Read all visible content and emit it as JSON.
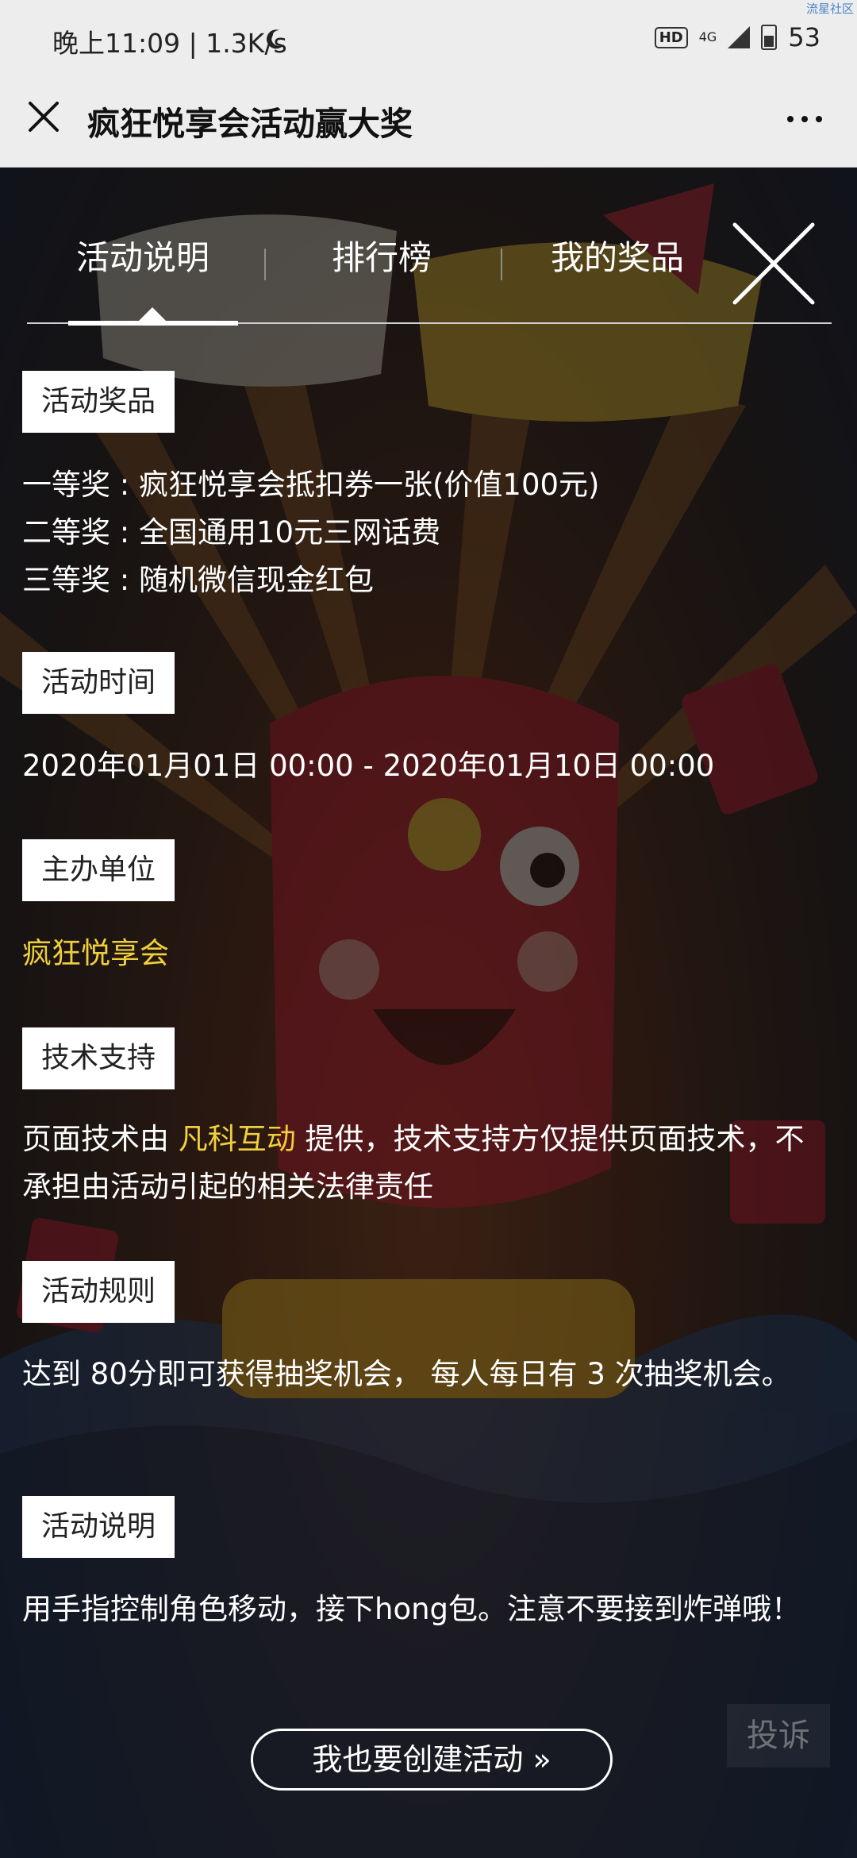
{
  "status_bar": {
    "left_text": "晚上11:09 | 1.3K/s",
    "hd": "HD",
    "network": "4G",
    "battery": "53",
    "watermark": "流星社区"
  },
  "header": {
    "title": "疯狂悦享会活动赢大奖"
  },
  "tabs": [
    "活动说明",
    "排行榜",
    "我的奖品"
  ],
  "sections": {
    "prizes": {
      "label": "活动奖品",
      "lines": [
        "一等奖 : 疯狂悦享会抵扣券一张(价值100元)",
        "二等奖 : 全国通用10元三网话费",
        "三等奖 : 随机微信现金红包"
      ]
    },
    "time": {
      "label": "活动时间",
      "text": "2020年01月01日 00:00 - 2020年01月10日 00:00"
    },
    "organizer": {
      "label": "主办单位",
      "text": "疯狂悦享会"
    },
    "tech": {
      "label": "技术支持",
      "prefix": "页面技术由 ",
      "provider": "凡科互动",
      "suffix": " 提供，技术支持方仅提供页面技术，不承担由活动引起的相关法律责任"
    },
    "rules": {
      "label": "活动规则",
      "text": "达到 80分即可获得抽奖机会， 每人每日有 3 次抽奖机会。"
    },
    "desc": {
      "label": "活动说明",
      "text": "用手指控制角色移动，接下hong包。注意不要接到炸弹哦！"
    }
  },
  "cta": {
    "label": "我也要创建活动 »"
  },
  "report_label": "投诉",
  "colors": {
    "accent_yellow": "#f0cf3a",
    "titlebar_bg": "#ededed"
  }
}
